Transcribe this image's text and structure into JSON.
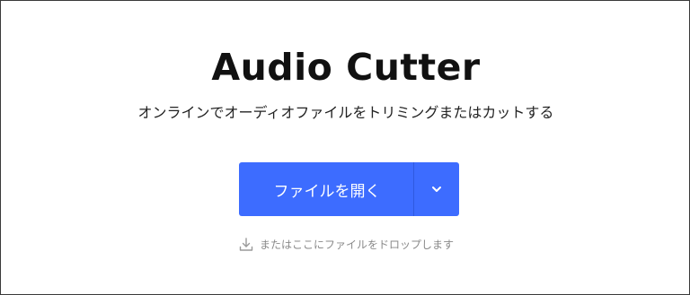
{
  "app": {
    "title": "Audio Cutter",
    "subtitle": "オンラインでオーディオファイルをトリミングまたはカットする"
  },
  "upload": {
    "open_file_label": "ファイルを開く",
    "dropdown_icon": "chevron-down-icon",
    "drop_hint": "またはここにファイルをドロップします",
    "drop_icon": "download-icon"
  },
  "colors": {
    "primary": "#3d6cff",
    "title": "#111111",
    "hint": "#8a8a8a"
  }
}
